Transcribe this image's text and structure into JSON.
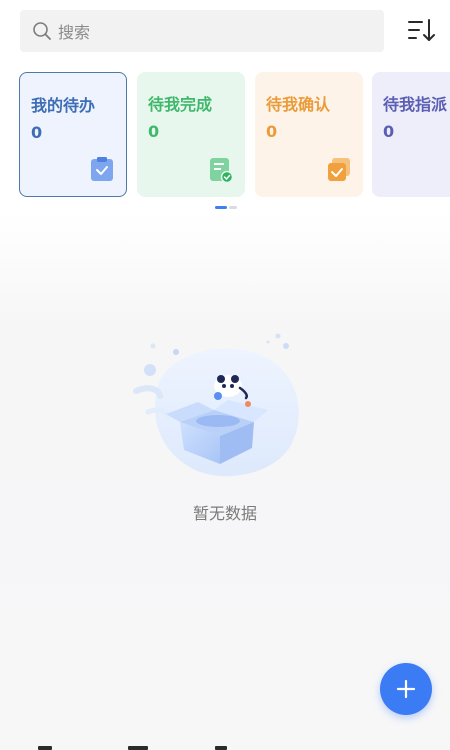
{
  "search": {
    "placeholder": "搜索"
  },
  "cards": [
    {
      "title": "我的待办",
      "count": "0",
      "icon": "clipboard-check-icon",
      "color": "#3d6db6"
    },
    {
      "title": "待我完成",
      "count": "0",
      "icon": "document-check-icon",
      "color": "#3fb86b"
    },
    {
      "title": "待我确认",
      "count": "0",
      "icon": "stack-check-icon",
      "color": "#eb9c3a"
    },
    {
      "title": "待我指派",
      "count": "0",
      "icon": "assign-doc-icon",
      "color": "#5b5fb3"
    }
  ],
  "empty_state": {
    "text": "暂无数据"
  },
  "fab": {
    "icon": "plus-icon",
    "color": "#3b7cf5"
  },
  "toolbar": {
    "sort_icon": "sort-descending-icon"
  }
}
